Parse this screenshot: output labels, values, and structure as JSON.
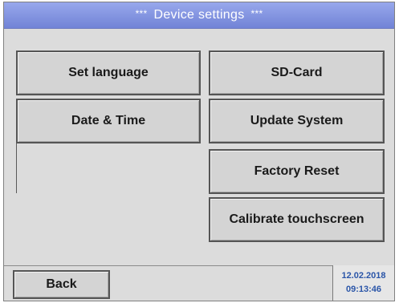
{
  "header": {
    "stars_left": "***",
    "title": "Device settings",
    "stars_right": "***"
  },
  "buttons": {
    "set_language": "Set language",
    "sd_card": "SD-Card",
    "date_time": "Date & Time",
    "update_system": "Update System",
    "factory_reset": "Factory Reset",
    "calibrate_touchscreen": "Calibrate touchscreen",
    "back": "Back"
  },
  "status": {
    "date": "12.02.2018",
    "time": "09:13:46"
  },
  "colors": {
    "titlebar": "#7f91dd",
    "background": "#dcdcdc",
    "button_face": "#d4d4d4",
    "datetime_text": "#2a55a8"
  }
}
